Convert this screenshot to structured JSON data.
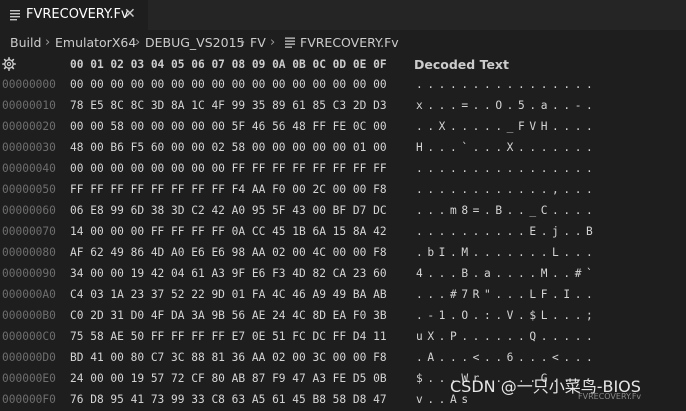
{
  "tab": {
    "label": "FVRECOVERY.Fv",
    "close": "✕"
  },
  "breadcrumb": {
    "items": [
      "Build",
      "EmulatorX64",
      "DEBUG_VS2015",
      "FV",
      "FVRECOVERY.Fv"
    ],
    "separator": "›"
  },
  "header": {
    "columns": "00 01 02 03 04 05 06 07 08 09 0A 0B 0C 0D 0E 0F",
    "decoded_title": "Decoded Text"
  },
  "rows": [
    {
      "offset": "00000000",
      "bytes": "00 00 00 00 00 00 00 00 00 00 00 00 00 00 00 00",
      "text": "................"
    },
    {
      "offset": "00000010",
      "bytes": "78 E5 8C 8C 3D 8A 1C 4F 99 35 89 61 85 C3 2D D3",
      "text": "x...=..O.5.a..-."
    },
    {
      "offset": "00000020",
      "bytes": "00 00 58 00 00 00 00 00 5F 46 56 48 FF FE 0C 00",
      "text": "..X....._FVH...."
    },
    {
      "offset": "00000030",
      "bytes": "48 00 B6 F5 60 00 00 02 58 00 00 00 00 00 01 00",
      "text": "H...`...X......."
    },
    {
      "offset": "00000040",
      "bytes": "00 00 00 00 00 00 00 00 FF FF FF FF FF FF FF FF",
      "text": "................"
    },
    {
      "offset": "00000050",
      "bytes": "FF FF FF FF FF FF FF FF F4 AA F0 00 2C 00 00 F8",
      "text": "............,..."
    },
    {
      "offset": "00000060",
      "bytes": "06 E8 99 6D 38 3D C2 42 A0 95 5F 43 00 BF D7 DC",
      "text": "...m8=.B.._C...."
    },
    {
      "offset": "00000070",
      "bytes": "14 00 00 00 FF FF FF FF 0A CC 45 1B 6A 15 8A 42",
      "text": "..........E.j..B"
    },
    {
      "offset": "00000080",
      "bytes": "AF 62 49 86 4D A0 E6 E6 98 AA 02 00 4C 00 00 F8",
      "text": ".bI.M.......L..."
    },
    {
      "offset": "00000090",
      "bytes": "34 00 00 19 42 04 61 A3 9F E6 F3 4D 82 CA 23 60",
      "text": "4...B.a....M..#`"
    },
    {
      "offset": "000000A0",
      "bytes": "C4 03 1A 23 37 52 22 9D 01 FA 4C 46 A9 49 BA AB",
      "text": "...#7R\"...LF.I.."
    },
    {
      "offset": "000000B0",
      "bytes": "C0 2D 31 D0 4F DA 3A 9B 56 AE 24 4C 8D EA F0 3B",
      "text": ".-1.O.:.V.$L...;"
    },
    {
      "offset": "000000C0",
      "bytes": "75 58 AE 50 FF FF FF FF E7 0E 51 FC DC FF D4 11",
      "text": "uX.P......Q....."
    },
    {
      "offset": "000000D0",
      "bytes": "BD 41 00 80 C7 3C 88 81 36 AA 02 00 3C 00 00 F8",
      "text": ".A...<..6...<..."
    },
    {
      "offset": "000000E0",
      "bytes": "24 00 00 19 57 72 CF 80 AB 87 F9 47 A3 FE D5 0B",
      "text": "$...Wr.....G...."
    },
    {
      "offset": "000000F0",
      "bytes": "76 D8 95 41 73 99 33 C8 63 A5 61 45 B8 58 D8 47",
      "text": "v..As"
    }
  ],
  "watermark": "CSDN @一只小菜鸟-BIOS",
  "mini_label": "FVRECOVERY.Fv",
  "colors": {
    "background": "#1e1e1e",
    "tabstrip": "#252526",
    "offset": "#6e6e6e",
    "text": "#d4d4d4"
  }
}
